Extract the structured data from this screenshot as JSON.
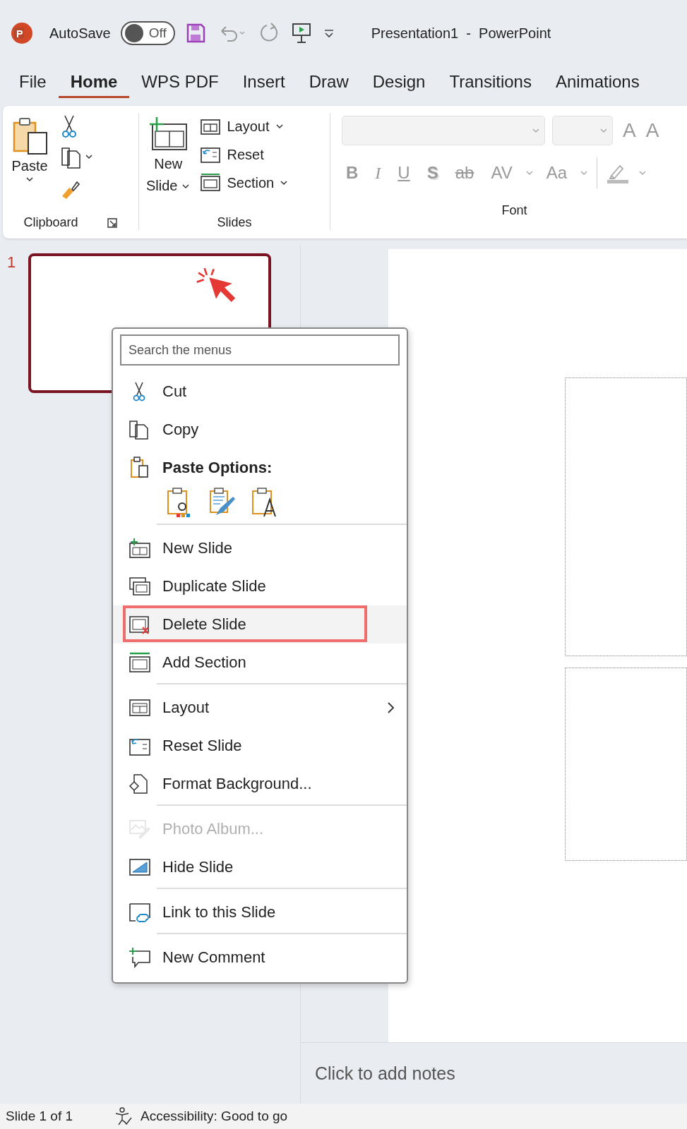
{
  "title_bar": {
    "autosave_label": "AutoSave",
    "autosave": {
      "on": false,
      "label": "Off"
    },
    "document_title": "Presentation1  -  PowerPoint"
  },
  "tabs": [
    {
      "label": "File",
      "selected": false
    },
    {
      "label": "Home",
      "selected": true
    },
    {
      "label": "WPS PDF",
      "selected": false
    },
    {
      "label": "Insert",
      "selected": false
    },
    {
      "label": "Draw",
      "selected": false
    },
    {
      "label": "Design",
      "selected": false
    },
    {
      "label": "Transitions",
      "selected": false
    },
    {
      "label": "Animations",
      "selected": false
    }
  ],
  "ribbon": {
    "clipboard": {
      "paste": "Paste",
      "label": "Clipboard"
    },
    "slides": {
      "new_slide": [
        "New",
        "Slide"
      ],
      "buttons": [
        "Layout",
        "Reset",
        "Section"
      ],
      "label": "Slides"
    },
    "font": {
      "size_buttons": [
        "A",
        "A"
      ],
      "format_buttons": [
        "B",
        "I",
        "U",
        "S",
        "ab",
        "AV",
        "Aa"
      ],
      "label": "Font"
    }
  },
  "slide_panel": {
    "thumbnails": [
      {
        "number": "1",
        "selected": true
      }
    ]
  },
  "context_menu": {
    "search": {
      "placeholder": "Search the menus"
    },
    "items": [
      {
        "kind": "item",
        "label": "Cut",
        "disabled": false,
        "highlighted": false,
        "submenu": false,
        "separator_before": false
      },
      {
        "kind": "item",
        "label": "Copy",
        "disabled": false,
        "highlighted": false,
        "submenu": false,
        "separator_before": false
      },
      {
        "kind": "header",
        "label": "Paste Options:"
      },
      {
        "kind": "paste_options"
      },
      {
        "kind": "item",
        "label": "New Slide",
        "disabled": false,
        "highlighted": false,
        "submenu": false,
        "separator_before": true
      },
      {
        "kind": "item",
        "label": "Duplicate Slide",
        "disabled": false,
        "highlighted": false,
        "submenu": false,
        "separator_before": false
      },
      {
        "kind": "item",
        "label": "Delete Slide",
        "disabled": false,
        "highlighted": true,
        "submenu": false,
        "separator_before": false
      },
      {
        "kind": "item",
        "label": "Add Section",
        "disabled": false,
        "highlighted": false,
        "submenu": false,
        "separator_before": false
      },
      {
        "kind": "item",
        "label": "Layout",
        "disabled": false,
        "highlighted": false,
        "submenu": true,
        "separator_before": true
      },
      {
        "kind": "item",
        "label": "Reset Slide",
        "disabled": false,
        "highlighted": false,
        "submenu": false,
        "separator_before": false
      },
      {
        "kind": "item",
        "label": "Format Background...",
        "disabled": false,
        "highlighted": false,
        "submenu": false,
        "separator_before": false
      },
      {
        "kind": "item",
        "label": "Photo Album...",
        "disabled": true,
        "highlighted": false,
        "submenu": false,
        "separator_before": true
      },
      {
        "kind": "item",
        "label": "Hide Slide",
        "disabled": false,
        "highlighted": false,
        "submenu": false,
        "separator_before": false
      },
      {
        "kind": "item",
        "label": "Link to this Slide",
        "disabled": false,
        "highlighted": false,
        "submenu": false,
        "separator_before": true
      },
      {
        "kind": "item",
        "label": "New Comment",
        "disabled": false,
        "highlighted": false,
        "submenu": false,
        "separator_before": true
      }
    ]
  },
  "notes": {
    "placeholder": "Click to add notes"
  },
  "status_bar": {
    "slide_count": "Slide 1 of 1",
    "accessibility": "Accessibility: Good to go"
  }
}
